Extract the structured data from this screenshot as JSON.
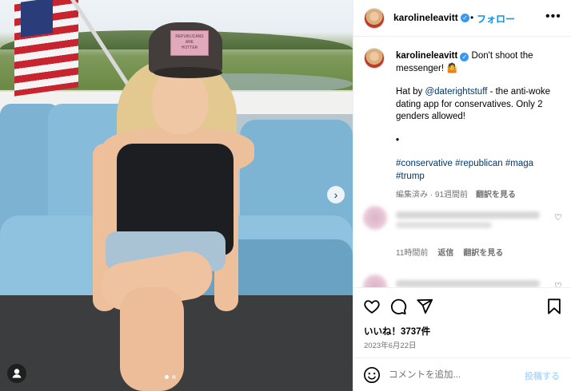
{
  "header": {
    "username": "karolineleavitt",
    "separator": "•",
    "follow_label": "フォロー",
    "more_label": "•••"
  },
  "photo": {
    "cap_text": "REPUBLICANS\nARE\nHOTTER",
    "next_label": "›",
    "user_tag_label": "●",
    "slide_count": 2,
    "current_slide": 1
  },
  "caption": {
    "username": "karolineleavitt",
    "line1": "Don't shoot the messenger! 🤷",
    "hat_prefix": "Hat by ",
    "hat_mention": "@daterightstuff",
    "hat_suffix": " - the anti-woke dating app for conservatives. Only 2 genders allowed!",
    "dot": "•",
    "hashtags": [
      "#conservative",
      "#republican",
      "#maga",
      "#trump"
    ],
    "meta_edited": "編集済み · 91週間前",
    "meta_translate": "翻訳を見る"
  },
  "comments": [
    {
      "time": "11時間前",
      "reply": "返信",
      "translate": "翻訳を見る"
    },
    {
      "time": "",
      "reply": "",
      "translate": ""
    }
  ],
  "actions": {
    "likes": "いいね！3737件",
    "date": "2023年6月22日"
  },
  "composer": {
    "placeholder": "コメントを追加...",
    "post_label": "投稿する"
  },
  "colors": {
    "accent": "#0095f6",
    "verified": "#3897f0",
    "link": "#00376b",
    "muted": "#737373"
  }
}
